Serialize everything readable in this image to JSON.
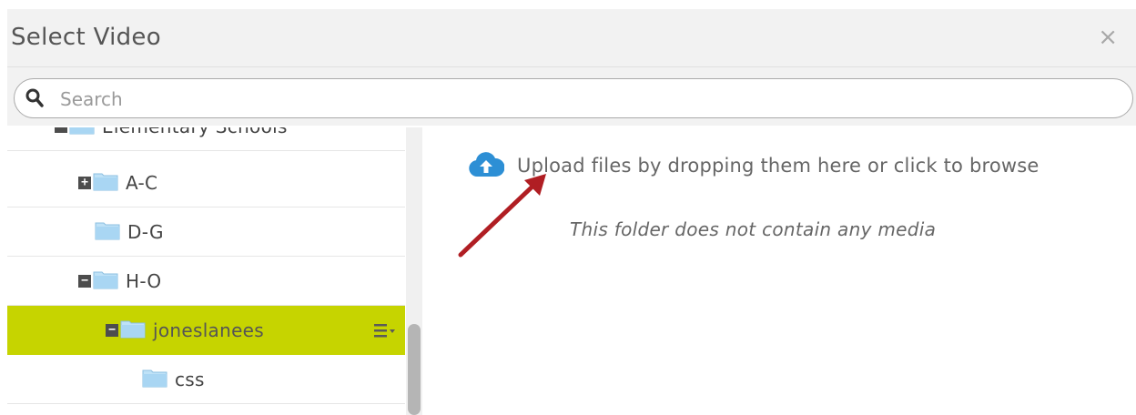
{
  "dialog": {
    "title": "Select Video",
    "close_label": "×"
  },
  "search": {
    "placeholder": "Search",
    "value": ""
  },
  "tree": {
    "items": [
      {
        "label": "Elementary Schools",
        "expander": "−",
        "expanded": true,
        "level": 1
      },
      {
        "label": "A-C",
        "expander": "+",
        "expanded": false,
        "level": 2
      },
      {
        "label": "D-G",
        "expander": "",
        "expanded": false,
        "level": 2
      },
      {
        "label": "H-O",
        "expander": "−",
        "expanded": true,
        "level": 2
      },
      {
        "label": "joneslanees",
        "expander": "−",
        "expanded": true,
        "level": 3,
        "selected": true
      },
      {
        "label": "css",
        "expander": "",
        "expanded": false,
        "level": 4
      }
    ],
    "selected_color": "#c6d400",
    "row_menu_icon": "list-menu-icon"
  },
  "main": {
    "upload_text": "Upload files by dropping them here or click to browse",
    "upload_icon": "cloud-upload-icon",
    "empty_message": "This folder does not contain any media",
    "accent_color": "#2d8fd5",
    "annotation_arrow_color": "#b01e23"
  }
}
